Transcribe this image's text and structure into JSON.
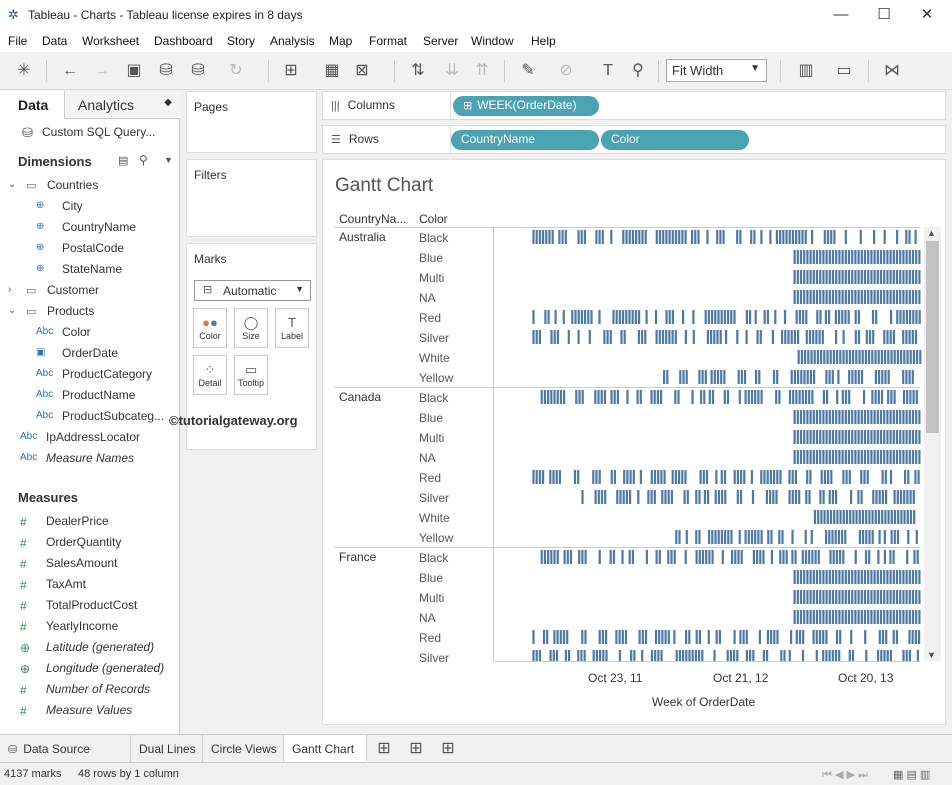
{
  "window": {
    "title": "Tableau - Charts - Tableau license expires in 8 days"
  },
  "menu": [
    "File",
    "Data",
    "Worksheet",
    "Dashboard",
    "Story",
    "Analysis",
    "Map",
    "Format",
    "Server",
    "Window",
    "Help"
  ],
  "toolbar": {
    "fit": "Fit Width"
  },
  "data_pane": {
    "tab_data": "Data",
    "tab_analytics": "Analytics",
    "datasource": "Custom SQL Query...",
    "dimensions_header": "Dimensions",
    "measures_header": "Measures",
    "dimensions": [
      {
        "label": "Countries",
        "type": "folder"
      },
      {
        "label": "City",
        "type": "geo"
      },
      {
        "label": "CountryName",
        "type": "geo"
      },
      {
        "label": "PostalCode",
        "type": "geo"
      },
      {
        "label": "StateName",
        "type": "geo"
      },
      {
        "label": "Customer",
        "type": "folder"
      },
      {
        "label": "Products",
        "type": "folder"
      },
      {
        "label": "Color",
        "type": "abc"
      },
      {
        "label": "OrderDate",
        "type": "date"
      },
      {
        "label": "ProductCategory",
        "type": "abc"
      },
      {
        "label": "ProductName",
        "type": "abc"
      },
      {
        "label": "ProductSubcateg...",
        "type": "abc"
      },
      {
        "label": "IpAddressLocator",
        "type": "abc"
      },
      {
        "label": "Measure Names",
        "type": "abc"
      }
    ],
    "measures": [
      {
        "label": "DealerPrice",
        "type": "num"
      },
      {
        "label": "OrderQuantity",
        "type": "num"
      },
      {
        "label": "SalesAmount",
        "type": "num"
      },
      {
        "label": "TaxAmt",
        "type": "num"
      },
      {
        "label": "TotalProductCost",
        "type": "num"
      },
      {
        "label": "YearlyIncome",
        "type": "num"
      },
      {
        "label": "Latitude (generated)",
        "type": "geo"
      },
      {
        "label": "Longitude (generated)",
        "type": "geo"
      },
      {
        "label": "Number of Records",
        "type": "num"
      },
      {
        "label": "Measure Values",
        "type": "num"
      }
    ]
  },
  "shelves": {
    "pages": "Pages",
    "filters": "Filters",
    "marks": "Marks",
    "mark_type": "Automatic",
    "mark_cards": [
      "Color",
      "Size",
      "Label",
      "Detail",
      "Tooltip"
    ],
    "columns_label": "Columns",
    "rows_label": "Rows",
    "columns_pills": [
      "WEEK(OrderDate)"
    ],
    "rows_pills": [
      "CountryName",
      "Color"
    ]
  },
  "view": {
    "title": "Gantt Chart",
    "col_header_country": "CountryNa...",
    "col_header_color": "Color"
  },
  "watermark": "©tutorialgateway.org",
  "chart_data": {
    "type": "gantt",
    "title": "Gantt Chart",
    "xlabel": "Week of OrderDate",
    "x_ticks": [
      "Oct 23, 11",
      "Oct 21, 12",
      "Oct 20, 13"
    ],
    "rows": [
      {
        "country": "Australia",
        "colors": [
          "Black",
          "Blue",
          "Multi",
          "NA",
          "Red",
          "Silver",
          "White",
          "Yellow"
        ],
        "coverage": [
          [
            0.05,
            1.0
          ],
          [
            0.69,
            1.0
          ],
          [
            0.69,
            1.0
          ],
          [
            0.69,
            1.0
          ],
          [
            0.05,
            1.0
          ],
          [
            0.05,
            1.0
          ],
          [
            0.7,
            1.0
          ],
          [
            0.37,
            1.0
          ]
        ]
      },
      {
        "country": "Canada",
        "colors": [
          "Black",
          "Blue",
          "Multi",
          "NA",
          "Red",
          "Silver",
          "White",
          "Yellow"
        ],
        "coverage": [
          [
            0.07,
            1.0
          ],
          [
            0.69,
            1.0
          ],
          [
            0.69,
            1.0
          ],
          [
            0.69,
            1.0
          ],
          [
            0.05,
            1.0
          ],
          [
            0.17,
            1.0
          ],
          [
            0.74,
            0.99
          ],
          [
            0.4,
            1.0
          ]
        ]
      },
      {
        "country": "France",
        "colors": [
          "Black",
          "Blue",
          "Multi",
          "NA",
          "Red",
          "Silver"
        ],
        "coverage": [
          [
            0.07,
            1.0
          ],
          [
            0.69,
            1.0
          ],
          [
            0.69,
            1.0
          ],
          [
            0.69,
            1.0
          ],
          [
            0.05,
            1.0
          ],
          [
            0.05,
            1.0
          ]
        ]
      }
    ]
  },
  "sheet_tabs": [
    "Data Source",
    "Dual Lines",
    "Circle Views",
    "Gantt Chart"
  ],
  "active_tab": "Gantt Chart",
  "status": {
    "marks": "4137 marks",
    "rows": "48 rows by 1 column"
  }
}
